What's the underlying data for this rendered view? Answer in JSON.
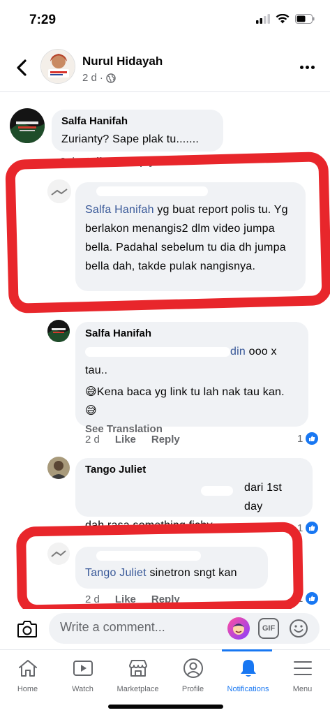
{
  "status_bar": {
    "time": "7:29"
  },
  "post": {
    "author": "Nurul Hidayah",
    "time": "2 d",
    "audience_icon": "globe-icon"
  },
  "comments": [
    {
      "name": "Salfa Hanifah",
      "text": "Zurianty? Sape plak tu.......",
      "time": "2 d",
      "like": "Like",
      "reply": "Reply"
    },
    {
      "mention": "Salfa Hanifah",
      "text": "yg buat report polis tu. Yg berlakon menangis2 dlm video jumpa bella. Padahal sebelum tu dia dh jumpa bella dah, takde pulak nangisnya.",
      "highlighted": true
    },
    {
      "name": "Salfa Hanifah",
      "mention_partial": "din",
      "text_line1": "ooo x tau..",
      "text_line2": "Kena baca yg link tu lah nak tau kan.",
      "see_translation": "See Translation",
      "time": "2 d",
      "like": "Like",
      "reply": "Reply",
      "reaction_count": "1"
    },
    {
      "name": "Tango Juliet",
      "text_line1": "dari 1st day",
      "text_line2": "dah rasa something fishy",
      "reaction_count": "1"
    },
    {
      "mention": "Tango Juliet",
      "text": "sinetron sngt kan",
      "time": "2 d",
      "like": "Like",
      "reply": "Reply",
      "reaction_count": "1",
      "highlighted": true
    }
  ],
  "composer": {
    "placeholder": "Write a comment...",
    "gif_label": "GIF"
  },
  "tabs": [
    {
      "label": "Home",
      "icon": "home-icon"
    },
    {
      "label": "Watch",
      "icon": "watch-icon"
    },
    {
      "label": "Marketplace",
      "icon": "marketplace-icon"
    },
    {
      "label": "Profile",
      "icon": "profile-icon"
    },
    {
      "label": "Notifications",
      "icon": "bell-icon",
      "active": true
    },
    {
      "label": "Menu",
      "icon": "menu-icon"
    }
  ],
  "colors": {
    "accent": "#1877f2",
    "highlight_box": "#e8262b",
    "bubble": "#f0f2f5",
    "secondary_text": "#65676b",
    "mention": "#385898"
  }
}
